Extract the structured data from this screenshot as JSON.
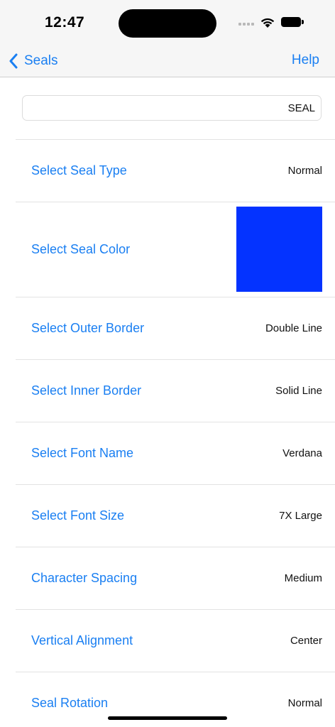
{
  "status_bar": {
    "time": "12:47"
  },
  "nav": {
    "back_label": "Seals",
    "help_label": "Help"
  },
  "text_field": {
    "value": "SEAL"
  },
  "settings": {
    "seal_type": {
      "label": "Select Seal Type",
      "value": "Normal"
    },
    "seal_color": {
      "label": "Select Seal Color",
      "color": "#0433ff"
    },
    "outer_border": {
      "label": "Select Outer Border",
      "value": "Double Line"
    },
    "inner_border": {
      "label": "Select Inner Border",
      "value": "Solid Line"
    },
    "font_name": {
      "label": "Select Font Name",
      "value": "Verdana"
    },
    "font_size": {
      "label": "Select Font Size",
      "value": "7X Large"
    },
    "char_spacing": {
      "label": "Character Spacing",
      "value": "Medium"
    },
    "vertical_align": {
      "label": "Vertical Alignment",
      "value": "Center"
    },
    "rotation": {
      "label": "Seal Rotation",
      "value": "Normal"
    }
  },
  "colors": {
    "accent": "#1a7ff2",
    "seal_color": "#0433ff"
  },
  "icons": {
    "back": "chevron-left-icon",
    "wifi": "wifi-icon",
    "battery": "battery-icon",
    "signal": "cellular-signal-icon"
  }
}
